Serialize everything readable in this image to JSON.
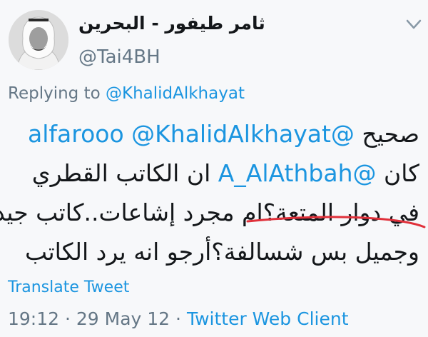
{
  "author": {
    "display_name": "ثامر طيفور - البحرين",
    "handle": "@Tai4BH",
    "avatar_icon": "user-avatar-portrait"
  },
  "menu_icon": "chevron-down-icon",
  "replying": {
    "prefix": "Replying to ",
    "mention": "@KhalidAlkhayat"
  },
  "tweet": {
    "line1": {
      "word": "صحيح",
      "mention1": "@alfarooo",
      "mention2": "@KhalidAlkhayat"
    },
    "line2": {
      "word": "كان",
      "mention": "@A_AlAthbah",
      "rest": "ان الكاتب القطري"
    },
    "line3": "في دوار المتعة؟ام مجرد إشاعات..كاتب جيد",
    "line4": "وجميل بس شسالفة؟أرجو انه يرد الكاتب"
  },
  "annotation": {
    "color": "#e0303a",
    "kind": "red-underline-mark"
  },
  "translate_label": "Translate Tweet",
  "meta": {
    "time": "19:12",
    "sep1": " · ",
    "date": "29 May 12",
    "sep2": " · ",
    "client": "Twitter Web Client"
  },
  "colors": {
    "link": "#1b95e0",
    "secondary": "#657786",
    "text": "#14171a"
  }
}
